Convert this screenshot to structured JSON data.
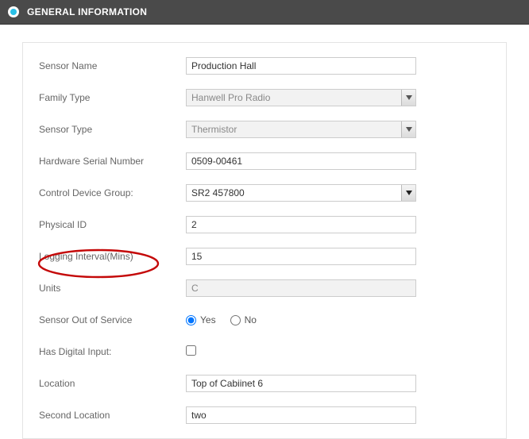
{
  "header": {
    "title": "GENERAL INFORMATION"
  },
  "labels": {
    "sensor_name": "Sensor Name",
    "family_type": "Family Type",
    "sensor_type": "Sensor Type",
    "hw_serial": "Hardware Serial Number",
    "ctrl_group": "Control Device Group:",
    "physical_id": "Physical ID",
    "log_interval": "Logging Interval(Mins)",
    "units": "Units",
    "out_of_service": "Sensor Out of Service",
    "has_digital": "Has Digital Input:",
    "location": "Location",
    "second_location": "Second Location"
  },
  "values": {
    "sensor_name": "Production Hall",
    "family_type": "Hanwell Pro Radio",
    "sensor_type": "Thermistor",
    "hw_serial": "0509-00461",
    "ctrl_group": "SR2 457800",
    "physical_id": "2",
    "log_interval": "15",
    "units": "C",
    "out_of_service_yes": "Yes",
    "out_of_service_no": "No",
    "out_of_service_selected": "yes",
    "has_digital_checked": false,
    "location": "Top of Cabiinet 6",
    "second_location": "two"
  }
}
